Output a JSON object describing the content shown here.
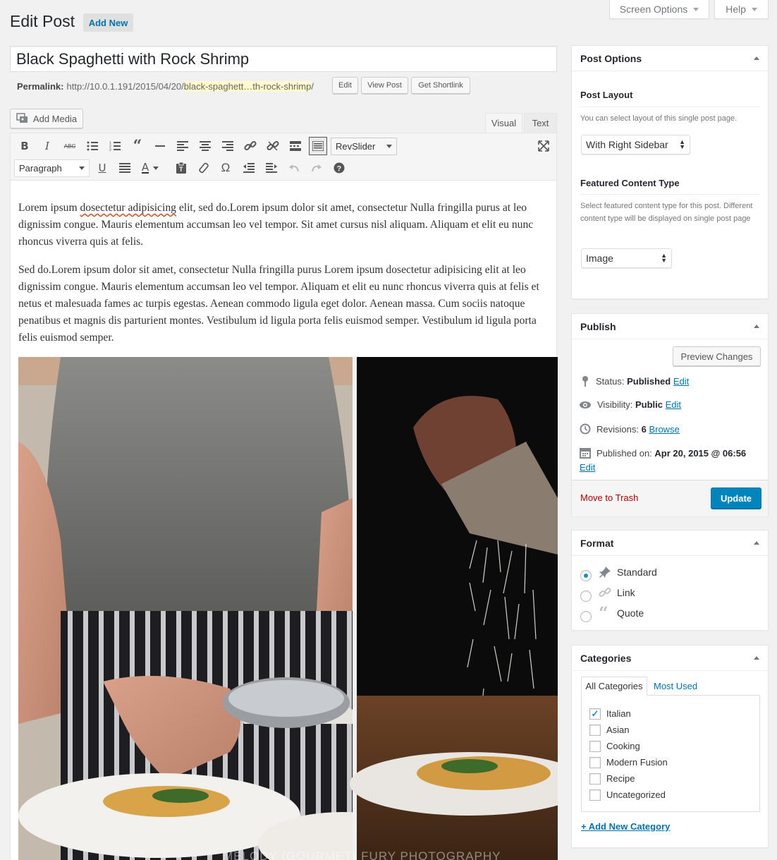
{
  "header": {
    "title": "Edit Post",
    "add_new": "Add New",
    "screen_options": "Screen Options",
    "help": "Help"
  },
  "post": {
    "title": "Black Spaghetti with Rock Shrimp",
    "permalink_label": "Permalink:",
    "permalink_base": "http://10.0.1.191/2015/04/20/",
    "permalink_slug": "black-spaghett…th-rock-shrimp",
    "permalink_end": "/",
    "edit_btn": "Edit",
    "view_btn": "View Post",
    "shortlink_btn": "Get Shortlink"
  },
  "editor": {
    "add_media": "Add Media",
    "tab_visual": "Visual",
    "tab_text": "Text",
    "revslider": "RevSlider",
    "format_select": "Paragraph",
    "toolbar_row1_icons": [
      "bold-icon",
      "italic-icon",
      "strikethrough-icon",
      "bullet-list-icon",
      "numbered-list-icon",
      "blockquote-icon",
      "horizontal-line-icon",
      "align-left-icon",
      "align-center-icon",
      "align-right-icon",
      "link-icon",
      "unlink-icon",
      "read-more-icon",
      "toolbar-toggle-icon"
    ],
    "toolbar_row2_icons": [
      "underline-icon",
      "justify-icon",
      "text-color-icon",
      "paste-text-icon",
      "clear-format-icon",
      "special-char-icon",
      "outdent-icon",
      "indent-icon",
      "undo-icon",
      "redo-icon",
      "help-icon"
    ],
    "para1_a": "Lorem ipsum ",
    "para1_misspelled": "dosectetur adipisicing",
    "para1_b": " elit, sed do.Lorem ipsum dolor sit amet, consectetur Nulla fringilla purus at leo dignissim congue. Mauris elementum accumsan leo vel tempor. Sit amet cursus nisl aliquam. Aliquam et elit eu nunc rhoncus viverra quis at felis.",
    "para2": "Sed do.Lorem ipsum dolor sit amet, consectetur Nulla fringilla purus Lorem ipsum dosectetur adipisicing elit at leo dignissim congue. Mauris elementum accumsan leo vel tempor. Aliquam et elit eu nunc rhoncus viverra quis at felis et netus et malesuada fames ac turpis egestas. Aenean commodo ligula eget dolor. Aenean massa. Cum sociis natoque penatibus et magnis dis parturient montes. Vestibulum id ligula porta felis euismod semper. Vestibulum id ligula porta felis euismod semper.",
    "image_watermark": "MELODY {GOURMET} FURY PHOTOGRAPHY"
  },
  "post_options": {
    "title": "Post Options",
    "layout_label": "Post Layout",
    "layout_desc": "You can select layout of this single post page.",
    "layout_value": "With Right Sidebar",
    "featured_label": "Featured Content Type",
    "featured_desc": "Select featured content type for this post. Different content type will be displayed on single post page",
    "featured_value": "Image"
  },
  "publish": {
    "title": "Publish",
    "preview": "Preview Changes",
    "status_label": "Status:",
    "status_value": "Published",
    "visibility_label": "Visibility:",
    "visibility_value": "Public",
    "revisions_label": "Revisions:",
    "revisions_value": "6",
    "browse": "Browse",
    "published_label": "Published on:",
    "published_value": "Apr 20, 2015 @ 06:56",
    "edit": "Edit",
    "trash": "Move to Trash",
    "update": "Update"
  },
  "format": {
    "title": "Format",
    "options": [
      "Standard",
      "Link",
      "Quote"
    ],
    "selected": "Standard"
  },
  "categories": {
    "title": "Categories",
    "tab_all": "All Categories",
    "tab_used": "Most Used",
    "items": [
      {
        "label": "Italian",
        "checked": true
      },
      {
        "label": "Asian",
        "checked": false
      },
      {
        "label": "Cooking",
        "checked": false
      },
      {
        "label": "Modern Fusion",
        "checked": false
      },
      {
        "label": "Recipe",
        "checked": false
      },
      {
        "label": "Uncategorized",
        "checked": false
      }
    ],
    "add_new": "+ Add New Category"
  },
  "colors": {
    "primary": "#0085ba",
    "link": "#0073aa",
    "trash": "#a00",
    "background": "#f1f1f1"
  }
}
